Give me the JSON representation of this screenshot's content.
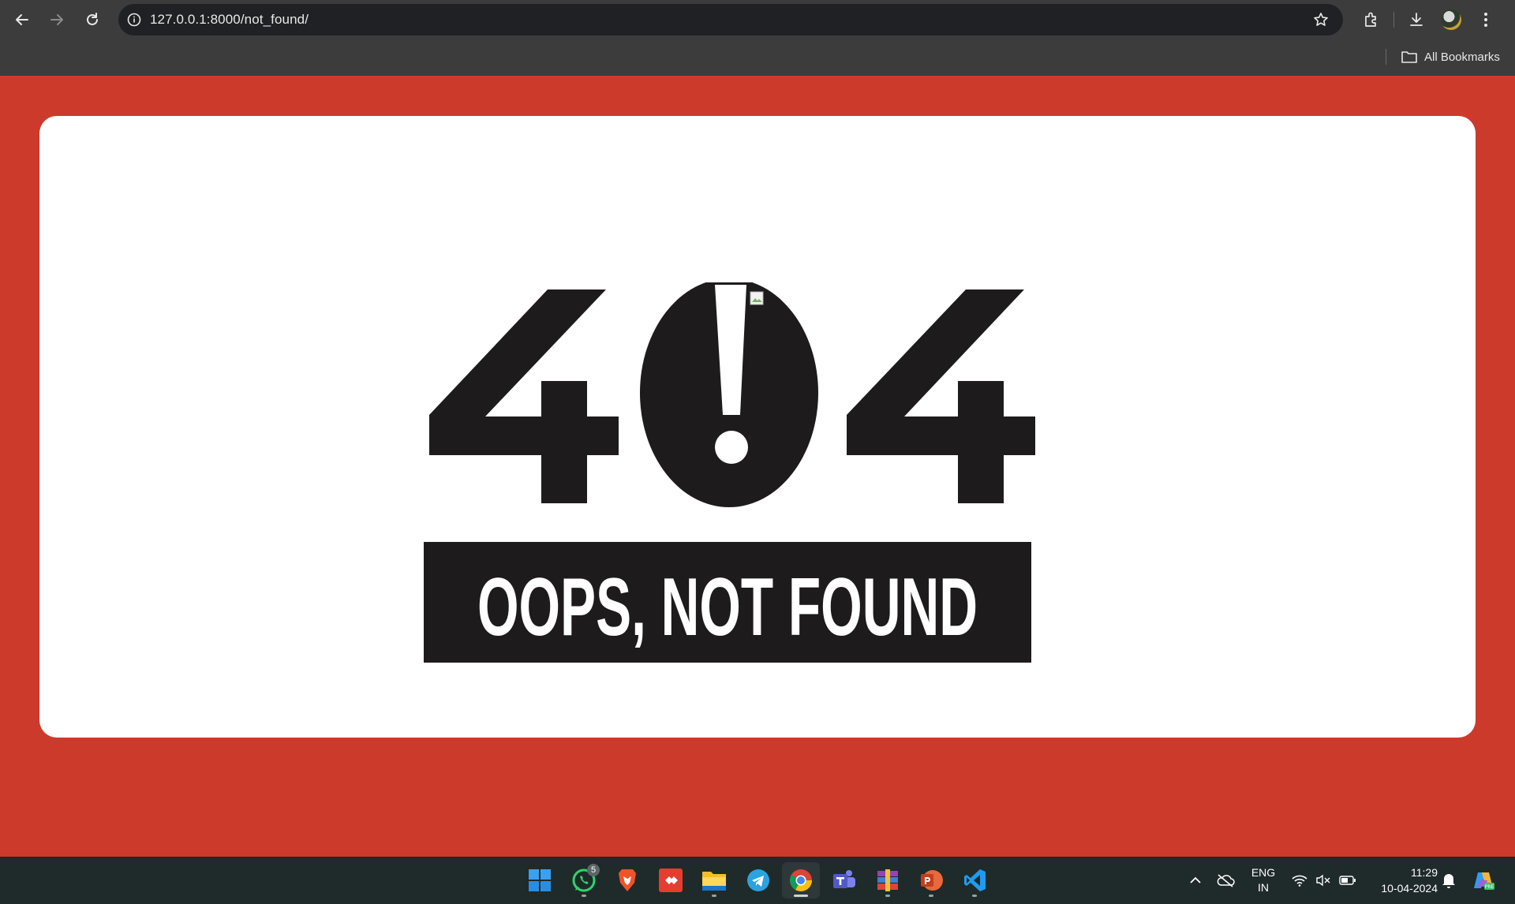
{
  "browser": {
    "url": "127.0.0.1:8000/not_found/",
    "bookmarks_label": "All Bookmarks",
    "icons": [
      "back-arrow-icon",
      "forward-arrow-icon",
      "reload-icon",
      "site-info-icon",
      "star-icon",
      "extensions-icon",
      "download-icon",
      "profile-avatar",
      "more-menu-icon",
      "folder-icon"
    ]
  },
  "page": {
    "background_color": "#cc3a2c",
    "art": {
      "big_text_left": "4",
      "big_text_right": "4",
      "banner": "OOPS, NOT FOUND"
    }
  },
  "taskbar": {
    "apps": [
      {
        "name": "windows-start",
        "icon": "windows-logo-icon"
      },
      {
        "name": "whatsapp",
        "icon": "whatsapp-icon",
        "badge": "5"
      },
      {
        "name": "brave",
        "icon": "brave-lion-icon"
      },
      {
        "name": "anydesk",
        "icon": "anydesk-icon"
      },
      {
        "name": "file-explorer",
        "icon": "folder-icon"
      },
      {
        "name": "telegram",
        "icon": "telegram-icon"
      },
      {
        "name": "chrome",
        "icon": "chrome-icon"
      },
      {
        "name": "teams",
        "icon": "teams-icon"
      },
      {
        "name": "winrar",
        "icon": "winrar-icon"
      },
      {
        "name": "powerpoint",
        "icon": "powerpoint-icon"
      },
      {
        "name": "vscode",
        "icon": "vscode-icon"
      }
    ],
    "tray": {
      "lang_line1": "ENG",
      "lang_line2": "IN",
      "time": "11:29",
      "date": "10-04-2024"
    }
  }
}
